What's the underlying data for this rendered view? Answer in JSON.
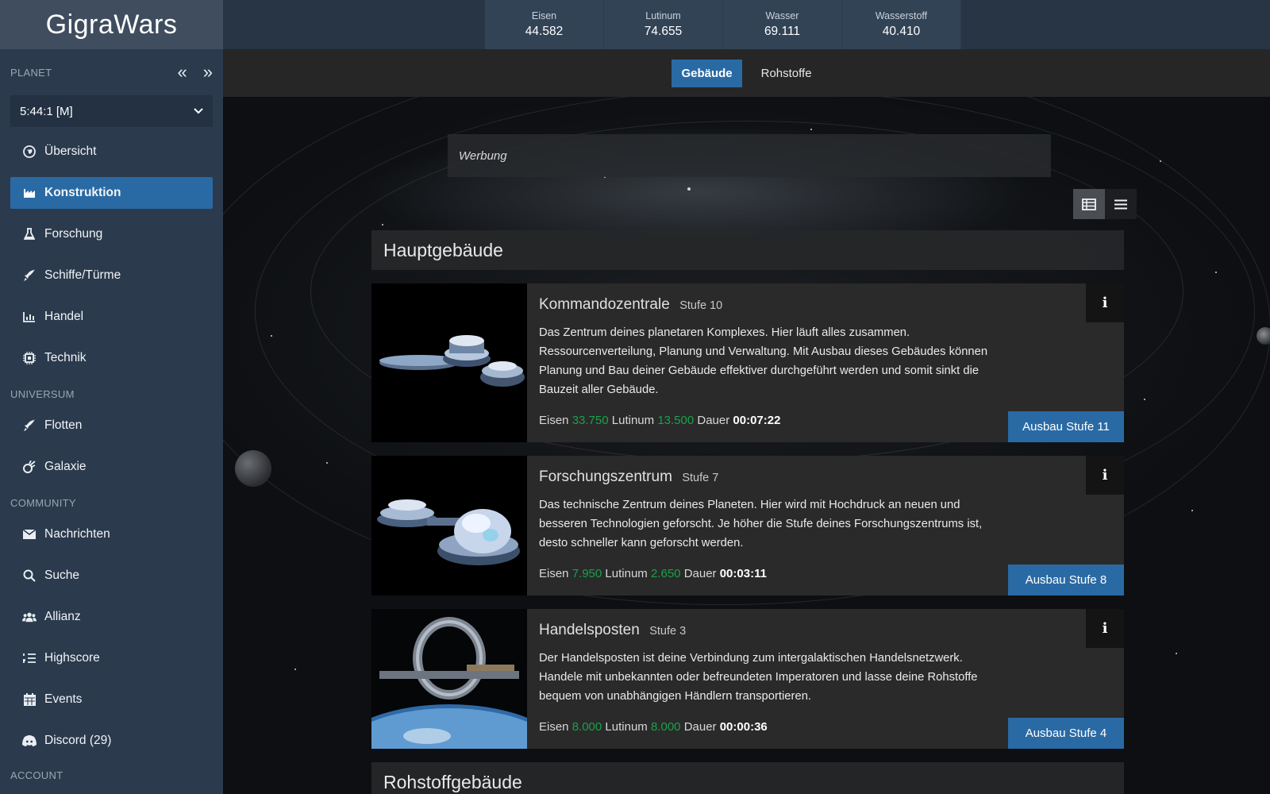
{
  "app": {
    "logo": "GigraWars"
  },
  "resources": [
    {
      "name": "Eisen",
      "value": "44.582"
    },
    {
      "name": "Lutinum",
      "value": "74.655"
    },
    {
      "name": "Wasser",
      "value": "69.111"
    },
    {
      "name": "Wasserstoff",
      "value": "40.410"
    }
  ],
  "sidebar": {
    "planet_label": "PLANET",
    "prev_icon": "double-chevron-left-icon",
    "next_icon": "double-chevron-right-icon",
    "planet_select": {
      "value": "5:44:1 [M]",
      "icon": "chevron-down-icon"
    },
    "items": [
      {
        "label": "Übersicht",
        "icon": "globe-icon"
      },
      {
        "label": "Konstruktion",
        "icon": "factory-icon",
        "active": true
      },
      {
        "label": "Forschung",
        "icon": "flask-icon"
      },
      {
        "label": "Schiffe/Türme",
        "icon": "rocket-icon"
      },
      {
        "label": "Handel",
        "icon": "chart-icon"
      },
      {
        "label": "Technik",
        "icon": "cpu-icon"
      }
    ],
    "universum_label": "UNIVERSUM",
    "universum_items": [
      {
        "label": "Flotten",
        "icon": "rocket-icon"
      },
      {
        "label": "Galaxie",
        "icon": "meteor-icon"
      }
    ],
    "community_label": "COMMUNITY",
    "community_items": [
      {
        "label": "Nachrichten",
        "icon": "envelope-icon"
      },
      {
        "label": "Suche",
        "icon": "search-icon"
      },
      {
        "label": "Allianz",
        "icon": "users-icon"
      },
      {
        "label": "Highscore",
        "icon": "list-ordered-icon"
      },
      {
        "label": "Events",
        "icon": "calendar-icon"
      },
      {
        "label": "Discord (29)",
        "icon": "discord-icon"
      }
    ],
    "account_label": "ACCOUNT"
  },
  "tabs": [
    {
      "label": "Gebäude",
      "active": true
    },
    {
      "label": "Rohstoffe",
      "active": false
    }
  ],
  "ad": {
    "label": "Werbung"
  },
  "view_toggle": {
    "grid_icon": "table-list-icon",
    "list_icon": "hamburger-list-icon"
  },
  "section": {
    "title": "Hauptgebäude"
  },
  "buildings": [
    {
      "name": "Kommandozentrale",
      "level": "Stufe 10",
      "description": "Das Zentrum deines planetaren Komplexes. Hier läuft alles zusammen. Ressourcenverteilung, Planung und Verwaltung. Mit Ausbau dieses Gebäudes können Planung und Bau deiner Gebäude effektiver durchgeführt werden und somit sinkt die Bauzeit aller Gebäude.",
      "cost_label_1": "Eisen",
      "cost_1": "33.750",
      "cost_label_2": "Lutinum",
      "cost_2": "13.500",
      "duration_label": "Dauer",
      "duration": "00:07:22",
      "info": "i",
      "button": "Ausbau Stufe 11"
    },
    {
      "name": "Forschungszentrum",
      "level": "Stufe 7",
      "description": "Das technische Zentrum deines Planeten. Hier wird mit Hochdruck an neuen und besseren Technologien geforscht. Je höher die Stufe deines Forschungszentrums ist, desto schneller kann geforscht werden.",
      "cost_label_1": "Eisen",
      "cost_1": "7.950",
      "cost_label_2": "Lutinum",
      "cost_2": "2.650",
      "duration_label": "Dauer",
      "duration": "00:03:11",
      "info": "i",
      "button": "Ausbau Stufe 8"
    },
    {
      "name": "Handelsposten",
      "level": "Stufe 3",
      "description": "Der Handelsposten ist deine Verbindung zum intergalaktischen Handelsnetzwerk. Handele mit unbekannten oder befreundeten Imperatoren und lasse deine Rohstoffe bequem von unabhängigen Händlern transportieren.",
      "cost_label_1": "Eisen",
      "cost_1": "8.000",
      "cost_label_2": "Lutinum",
      "cost_2": "8.000",
      "duration_label": "Dauer",
      "duration": "00:00:36",
      "info": "i",
      "button": "Ausbau Stufe 4"
    }
  ],
  "next_section": {
    "title": "Rohstoffgebäude"
  },
  "colors": {
    "accent": "#2a6aa4",
    "sidebar": "#2b3a4d",
    "cost_green": "#19a24a"
  }
}
